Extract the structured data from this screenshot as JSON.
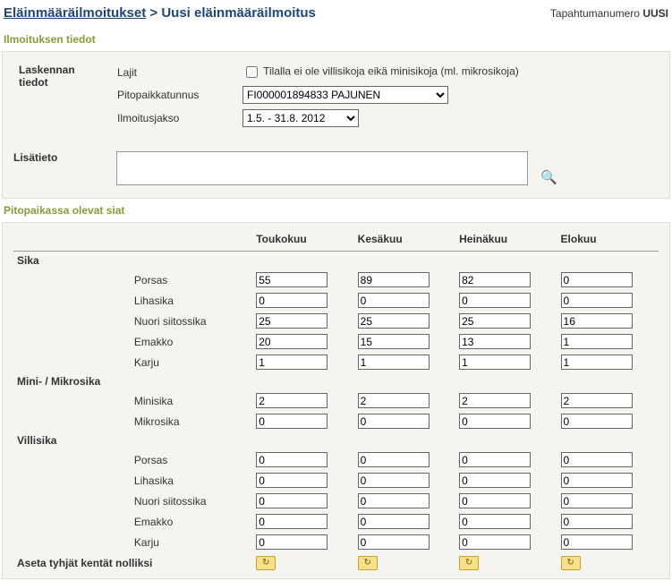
{
  "breadcrumb": {
    "root": "Eläinmääräilmoitukset",
    "sep": ">",
    "current": "Uusi eläinmääräilmoitus"
  },
  "event": {
    "label": "Tapahtumanumero",
    "value": "UUSI"
  },
  "section_info_title": "Ilmoituksen tiedot",
  "form": {
    "group_label": "Laskennan tiedot",
    "lajit_label": "Lajit",
    "no_pigs_checkbox_label": "Tilalla ei ole villisikoja eikä minisikoja (ml. mikrosikoja)",
    "pito_label": "Pitopaikkatunnus",
    "pito_value": "FI000001894833 PAJUNEN",
    "jakso_label": "Ilmoitusjakso",
    "jakso_value": "1.5. - 31.8. 2012",
    "lisatieto_label": "Lisätieto",
    "lisatieto_value": ""
  },
  "section_pigs_title": "Pitopaikassa olevat siat",
  "months": [
    "Toukokuu",
    "Kesäkuu",
    "Heinäkuu",
    "Elokuu"
  ],
  "groups": [
    {
      "name": "Sika",
      "rows": [
        {
          "label": "Porsas",
          "values": [
            "55",
            "89",
            "82",
            "0"
          ]
        },
        {
          "label": "Lihasika",
          "values": [
            "0",
            "0",
            "0",
            "0"
          ]
        },
        {
          "label": "Nuori siitossika",
          "values": [
            "25",
            "25",
            "25",
            "16"
          ]
        },
        {
          "label": "Emakko",
          "values": [
            "20",
            "15",
            "13",
            "1"
          ]
        },
        {
          "label": "Karju",
          "values": [
            "1",
            "1",
            "1",
            "1"
          ]
        }
      ]
    },
    {
      "name": "Mini- / Mikrosika",
      "rows": [
        {
          "label": "Minisika",
          "values": [
            "2",
            "2",
            "2",
            "2"
          ]
        },
        {
          "label": "Mikrosika",
          "values": [
            "0",
            "0",
            "0",
            "0"
          ]
        }
      ]
    },
    {
      "name": "Villisika",
      "rows": [
        {
          "label": "Porsas",
          "values": [
            "0",
            "0",
            "0",
            "0"
          ]
        },
        {
          "label": "Lihasika",
          "values": [
            "0",
            "0",
            "0",
            "0"
          ]
        },
        {
          "label": "Nuori siitossika",
          "values": [
            "0",
            "0",
            "0",
            "0"
          ]
        },
        {
          "label": "Emakko",
          "values": [
            "0",
            "0",
            "0",
            "0"
          ]
        },
        {
          "label": "Karju",
          "values": [
            "0",
            "0",
            "0",
            "0"
          ]
        }
      ]
    }
  ],
  "zero_label": "Aseta tyhjät kentät nolliksi"
}
